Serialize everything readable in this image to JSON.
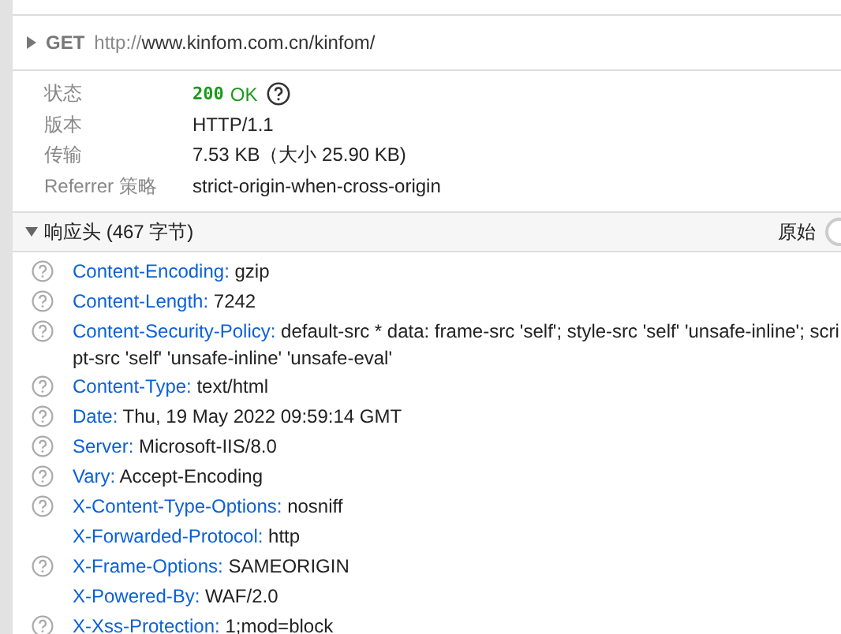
{
  "request": {
    "expanded": false,
    "method": "GET",
    "url_scheme": "http://",
    "url_rest": "www.kinfom.com.cn/kinfom/"
  },
  "summary": {
    "rows": [
      {
        "kind": "status",
        "label": "状态",
        "code": "200",
        "text": "OK"
      },
      {
        "kind": "plain",
        "label": "版本",
        "value": "HTTP/1.1"
      },
      {
        "kind": "plain",
        "label": "传输",
        "value": "7.53 KB（大小 25.90 KB)"
      },
      {
        "kind": "plain",
        "label": "Referrer 策略",
        "value": "strict-origin-when-cross-origin"
      }
    ]
  },
  "response_headers": {
    "expanded": true,
    "title": "响应头 (467 字节)",
    "raw_toggle": {
      "label": "原始",
      "on": false
    },
    "headers": [
      {
        "name": "Content-Encoding:",
        "value": "gzip",
        "help": true
      },
      {
        "name": "Content-Length:",
        "value": "7242",
        "help": true
      },
      {
        "name": "Content-Security-Policy:",
        "value": "default-src * data: frame-src 'self'; style-src 'self' 'unsafe-inline'; script-src 'self' 'unsafe-inline' 'unsafe-eval'",
        "help": true
      },
      {
        "name": "Content-Type:",
        "value": "text/html",
        "help": true
      },
      {
        "name": "Date:",
        "value": "Thu, 19 May 2022 09:59:14 GMT",
        "help": true
      },
      {
        "name": "Server:",
        "value": "Microsoft-IIS/8.0",
        "help": true
      },
      {
        "name": "Vary:",
        "value": "Accept-Encoding",
        "help": true
      },
      {
        "name": "X-Content-Type-Options:",
        "value": "nosniff",
        "help": true
      },
      {
        "name": "X-Forwarded-Protocol:",
        "value": "http",
        "help": false
      },
      {
        "name": "X-Frame-Options:",
        "value": "SAMEORIGIN",
        "help": true
      },
      {
        "name": "X-Powered-By:",
        "value": "WAF/2.0",
        "help": false
      },
      {
        "name": "X-Xss-Protection:",
        "value": "1;mod=block",
        "help": true
      }
    ]
  }
}
